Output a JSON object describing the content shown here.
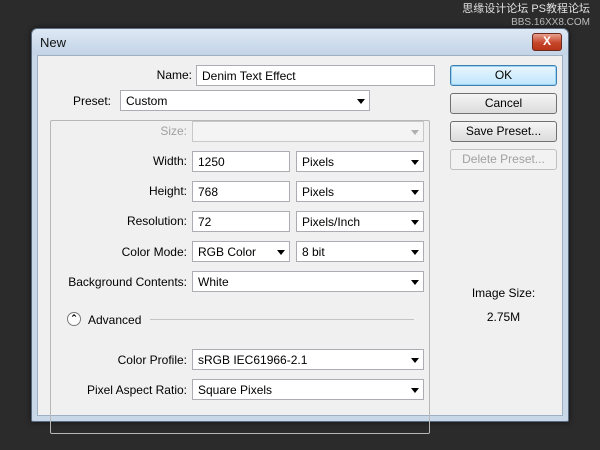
{
  "watermark": {
    "line1": "思缘设计论坛 PS教程论坛",
    "line2": "BBS.16XX8.COM"
  },
  "dialog": {
    "title": "New",
    "close_glyph": "X"
  },
  "name": {
    "label": "Name:",
    "value": "Denim Text Effect"
  },
  "preset": {
    "label": "Preset:",
    "value": "Custom"
  },
  "size": {
    "label": "Size:",
    "value": ""
  },
  "width": {
    "label": "Width:",
    "value": "1250",
    "unit": "Pixels"
  },
  "height": {
    "label": "Height:",
    "value": "768",
    "unit": "Pixels"
  },
  "resolution": {
    "label": "Resolution:",
    "value": "72",
    "unit": "Pixels/Inch"
  },
  "color_mode": {
    "label": "Color Mode:",
    "value": "RGB Color",
    "depth": "8 bit"
  },
  "background": {
    "label": "Background Contents:",
    "value": "White"
  },
  "advanced": {
    "label": "Advanced",
    "icon": "collapse-icon"
  },
  "color_profile": {
    "label": "Color Profile:",
    "value": "sRGB IEC61966-2.1"
  },
  "pixel_aspect": {
    "label": "Pixel Aspect Ratio:",
    "value": "Square Pixels"
  },
  "buttons": {
    "ok": "OK",
    "cancel": "Cancel",
    "save_preset": "Save Preset...",
    "delete_preset": "Delete Preset..."
  },
  "image_size": {
    "label": "Image Size:",
    "value": "2.75M"
  },
  "colors": {
    "accent": "#3c7fb1",
    "close": "#c6472b",
    "frame": "#c9d8e8"
  }
}
